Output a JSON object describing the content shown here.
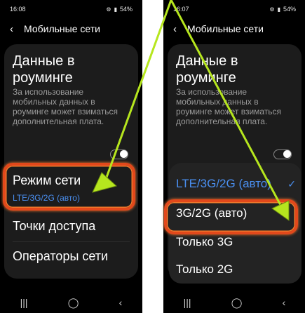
{
  "left": {
    "status": {
      "time": "16:08",
      "battery": "54%"
    },
    "header": {
      "back_icon": "‹",
      "title": "Мобильные сети"
    },
    "roaming": {
      "title": "Данные в роуминге",
      "description": "За использование мобильных данных в роуминге может взиматься дополнительная плата."
    },
    "network_mode": {
      "title": "Режим сети",
      "value": "LTE/3G/2G (авто)"
    },
    "access_points": "Точки доступа",
    "operators": "Операторы сети"
  },
  "right": {
    "status": {
      "time": "16:07",
      "battery": "54%"
    },
    "header": {
      "back_icon": "‹",
      "title": "Мобильные сети"
    },
    "roaming": {
      "title": "Данные в роуминге",
      "description": "За использование мобильных данных в роуминге может взиматься дополнительная плата."
    },
    "options": [
      {
        "label": "LTE/3G/2G (авто)",
        "selected": true
      },
      {
        "label": "3G/2G (авто)",
        "selected": false
      },
      {
        "label": "Только 3G",
        "selected": false
      },
      {
        "label": "Только 2G",
        "selected": false
      }
    ],
    "check_icon": "✓"
  },
  "colors": {
    "accent": "#4a8ff0",
    "highlight": "#e2481b",
    "arrow": "#b6e61e"
  }
}
